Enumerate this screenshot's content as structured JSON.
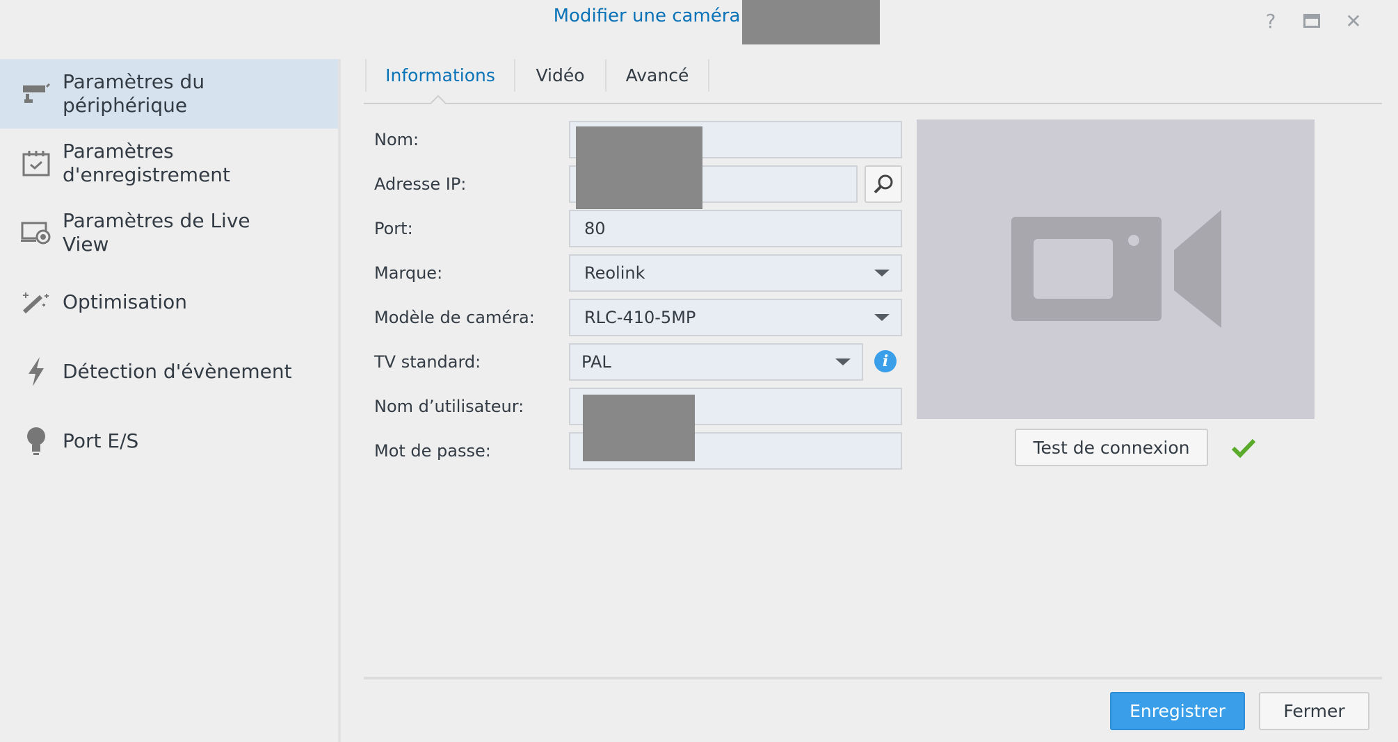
{
  "window": {
    "title": "Modifier une caméra",
    "help": "?",
    "close": "✕"
  },
  "sidebar": {
    "items": [
      {
        "label": "Paramètres du\npériphérique"
      },
      {
        "label": "Paramètres\nd'enregistrement"
      },
      {
        "label": "Paramètres de Live\nView"
      },
      {
        "label": "Optimisation"
      },
      {
        "label": "Détection d'évènement"
      },
      {
        "label": "Port E/S"
      }
    ]
  },
  "tabs": [
    {
      "label": "Informations"
    },
    {
      "label": "Vidéo"
    },
    {
      "label": "Avancé"
    }
  ],
  "form": {
    "name_label": "Nom:",
    "ip_label": "Adresse IP:",
    "port_label": "Port:",
    "port_value": "80",
    "brand_label": "Marque:",
    "brand_value": "Reolink",
    "model_label": "Modèle de caméra:",
    "model_value": "RLC-410-5MP",
    "tv_label": "TV standard:",
    "tv_value": "PAL",
    "user_label": "Nom d’utilisateur:",
    "password_label": "Mot de passe:"
  },
  "preview": {
    "test_button": "Test de connexion"
  },
  "footer": {
    "save": "Enregistrer",
    "close": "Fermer"
  },
  "colors": {
    "accent": "#0a73b8",
    "primary_button": "#3a9fe8",
    "success": "#5aab2c"
  }
}
